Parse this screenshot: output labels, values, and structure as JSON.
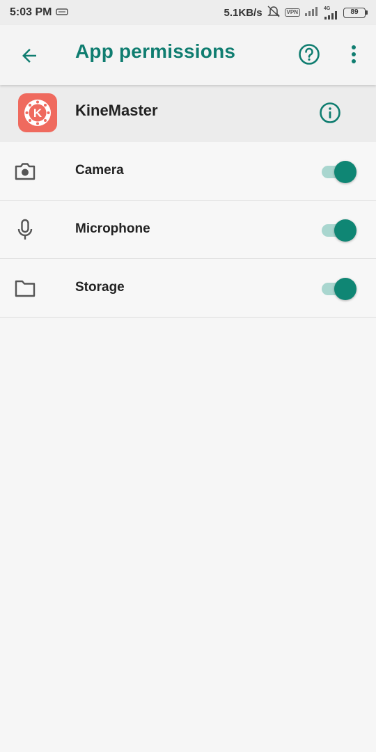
{
  "status_bar": {
    "time": "5:03 PM",
    "speed": "5.1KB/s",
    "vpn": "VPN",
    "network": "4G",
    "battery": "89"
  },
  "app_bar": {
    "title": "App permissions"
  },
  "app": {
    "name": "KineMaster",
    "icon_letter": "K"
  },
  "permissions": [
    {
      "label": "Camera",
      "enabled": true
    },
    {
      "label": "Microphone",
      "enabled": true
    },
    {
      "label": "Storage",
      "enabled": true
    }
  ],
  "colors": {
    "accent": "#0f7d70",
    "toggle_on": "#0f8674",
    "app_icon": "#ef6a5e"
  }
}
